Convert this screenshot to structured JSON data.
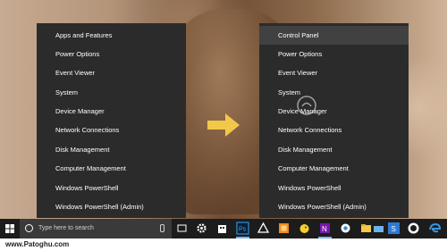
{
  "left_menu": {
    "items": [
      {
        "label": "Apps and Features"
      },
      {
        "label": "Power Options"
      },
      {
        "label": "Event Viewer"
      },
      {
        "label": "System"
      },
      {
        "label": "Device Manager"
      },
      {
        "label": "Network Connections"
      },
      {
        "label": "Disk Management"
      },
      {
        "label": "Computer Management"
      },
      {
        "label": "Windows PowerShell"
      },
      {
        "label": "Windows PowerShell (Admin)"
      }
    ]
  },
  "right_menu": {
    "highlighted_item": "Control Panel",
    "items": [
      {
        "label": "Control Panel"
      },
      {
        "label": "Power Options"
      },
      {
        "label": "Event Viewer"
      },
      {
        "label": "System"
      },
      {
        "label": "Device Manager"
      },
      {
        "label": "Network Connections"
      },
      {
        "label": "Disk Management"
      },
      {
        "label": "Computer Management"
      },
      {
        "label": "Windows PowerShell"
      },
      {
        "label": "Windows PowerShell (Admin)"
      }
    ]
  },
  "arrow": {
    "icon": "arrow-right-icon",
    "color": "#f2c84b"
  },
  "taskbar": {
    "search_placeholder": "Type here to search",
    "pinned_icons": [
      "task-view-icon",
      "settings-gear-icon",
      "store-icon",
      "photoshop-icon",
      "vector-app-icon",
      "box-app-icon",
      "paint-app-icon",
      "duck-app-icon",
      "onenote-icon",
      "camera-app-icon",
      "file-explorer-icon",
      "folder-icon",
      "outlook-icon",
      "s-app-icon",
      "media-app-icon",
      "edge-icon"
    ],
    "colors": {
      "bar": "#1c1c1c",
      "search": "#3a3a3a",
      "accent": "#7fb3f5"
    }
  },
  "footer": {
    "watermark_text": "www.Patoghu.com"
  },
  "colors": {
    "menu_bg": "#2b2b2b",
    "menu_highlight": "#414141",
    "menu_text": "#ffffff"
  }
}
